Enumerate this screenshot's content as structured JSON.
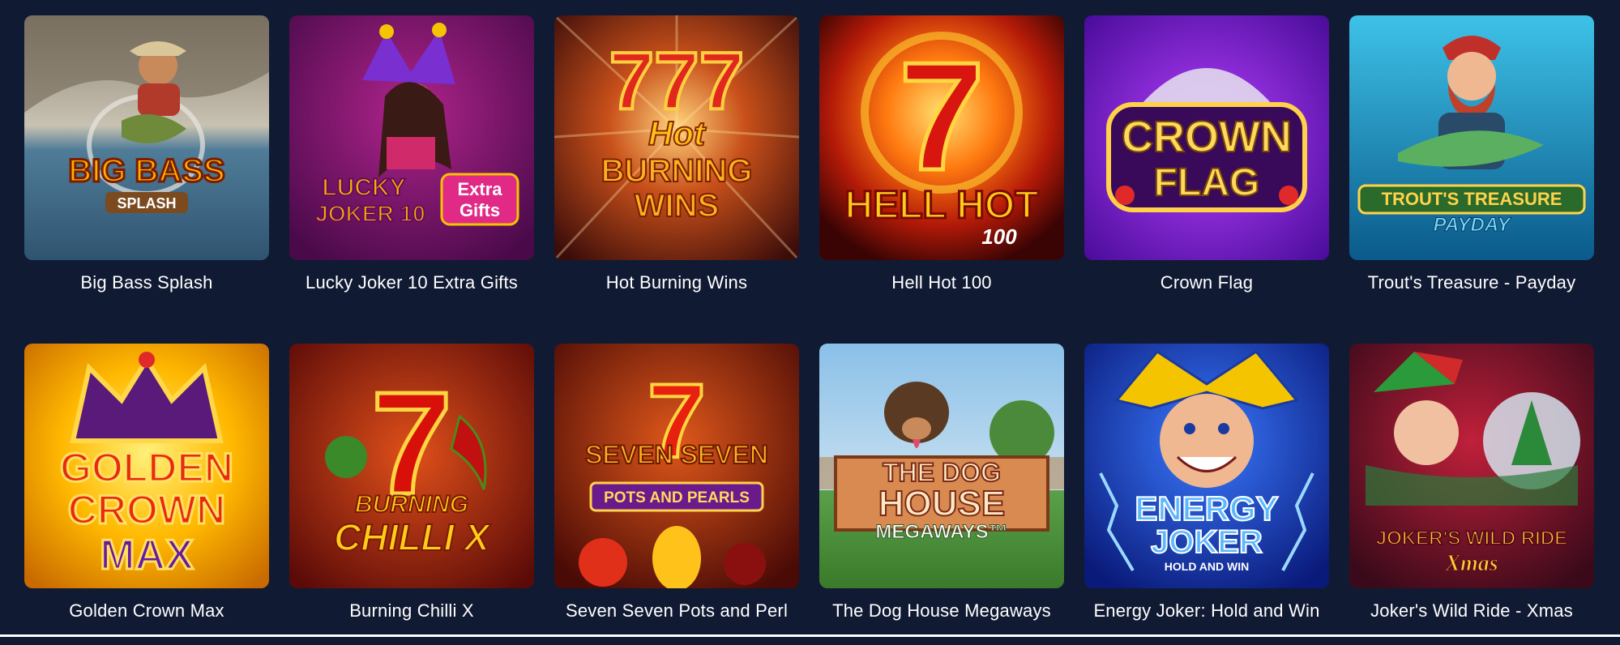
{
  "colors": {
    "page_background": "#111a33",
    "title_text": "#ffffff"
  },
  "games": [
    {
      "title": "Big Bass Splash",
      "art_text": [
        "BIG BASS",
        "SPLASH"
      ],
      "icon": "fisherman-icon"
    },
    {
      "title": "Lucky Joker 10 Extra Gifts",
      "art_text": [
        "LUCKY",
        "JOKER 10",
        "Extra",
        "Gifts"
      ],
      "icon": "joker-icon"
    },
    {
      "title": "Hot Burning Wins",
      "art_text": [
        "777",
        "Hot",
        "BURNING",
        "WINS"
      ],
      "icon": "sevens-icon"
    },
    {
      "title": "Hell Hot 100",
      "art_text": [
        "7",
        "HELL HOT",
        "100"
      ],
      "icon": "flaming-seven-icon"
    },
    {
      "title": "Crown Flag",
      "art_text": [
        "CROWN",
        "FLAG"
      ],
      "icon": "crown-flag-icon"
    },
    {
      "title": "Trout's Treasure - Payday",
      "art_text": [
        "TROUT'S TREASURE",
        "PAYDAY"
      ],
      "icon": "fisherman-icon"
    },
    {
      "title": "Golden Crown Max",
      "art_text": [
        "GOLDEN",
        "CROWN",
        "MAX"
      ],
      "icon": "crown-icon"
    },
    {
      "title": "Burning Chilli X",
      "art_text": [
        "7",
        "BURNING",
        "CHILLI X"
      ],
      "icon": "chilli-icon"
    },
    {
      "title": "Seven Seven Pots and Perl",
      "art_text": [
        "7",
        "SEVEN SEVEN",
        "POTS AND PEARLS"
      ],
      "icon": "fruit-seven-icon"
    },
    {
      "title": "The Dog House Megaways",
      "art_text": [
        "THE DOG",
        "HOUSE",
        "MEGAWAYS™"
      ],
      "icon": "dog-icon"
    },
    {
      "title": "Energy Joker: Hold and Win",
      "art_text": [
        "ENERGY",
        "JOKER",
        "HOLD AND WIN"
      ],
      "icon": "joker-icon"
    },
    {
      "title": "Joker's Wild Ride - Xmas",
      "art_text": [
        "JOKER'S WILD RIDE",
        "Xmas"
      ],
      "icon": "xmas-joker-icon"
    }
  ]
}
